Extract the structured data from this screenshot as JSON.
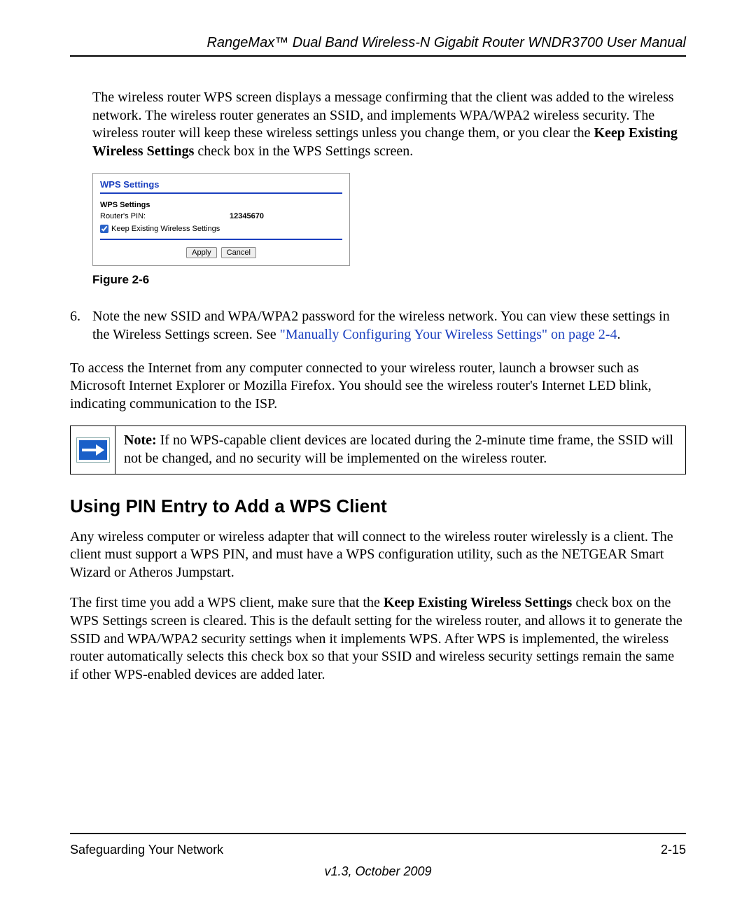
{
  "header": {
    "title": "RangeMax™ Dual Band Wireless-N Gigabit Router WNDR3700 User Manual"
  },
  "intro": {
    "p1_a": "The wireless router WPS screen displays a message confirming that the client was added to the wireless network. The wireless router generates an SSID, and implements WPA/WPA2 wireless security. The wireless router will keep these wireless settings unless you change them, or you clear the ",
    "p1_b": "Keep Existing Wireless Settings",
    "p1_c": " check box in the WPS Settings screen."
  },
  "figure": {
    "panel_title": "WPS Settings",
    "subheading": "WPS Settings",
    "pin_label": "Router's PIN:",
    "pin_value": "12345670",
    "checkbox_label": "Keep Existing Wireless Settings",
    "apply": "Apply",
    "cancel": "Cancel",
    "caption": "Figure 2-6"
  },
  "step6": {
    "num": "6.",
    "text_a": "Note the new SSID and WPA/WPA2 password for the wireless network. You can view these settings in the Wireless Settings screen. See ",
    "link": "\"Manually Configuring Your Wireless Settings\" on page 2-4",
    "text_b": "."
  },
  "access_para": "To access the Internet from any computer connected to your wireless router, launch a browser such as Microsoft Internet Explorer or Mozilla Firefox. You should see the wireless router's Internet LED blink, indicating communication to the ISP.",
  "note": {
    "label": "Note:",
    "body": " If no WPS-capable client devices are located during the 2-minute time frame, the SSID will not be changed, and no security will be implemented on the wireless router."
  },
  "section": {
    "heading": "Using PIN Entry to Add a WPS Client",
    "p1": "Any wireless computer or wireless adapter that will connect to the wireless router wirelessly is a client. The client must support a WPS PIN, and must have a WPS configuration utility, such as the NETGEAR Smart Wizard or Atheros Jumpstart.",
    "p2_a": "The first time you add a WPS client, make sure that the ",
    "p2_b": "Keep Existing Wireless Settings",
    "p2_c": " check box on the WPS Settings screen is cleared. This is the default setting for the wireless router, and allows it to generate the SSID and WPA/WPA2 security settings when it implements WPS. After WPS is implemented, the wireless router automatically selects this check box so that your SSID and wireless security settings remain the same if other WPS-enabled devices are added later."
  },
  "footer": {
    "left": "Safeguarding Your Network",
    "right": "2-15",
    "version": "v1.3, October 2009"
  }
}
